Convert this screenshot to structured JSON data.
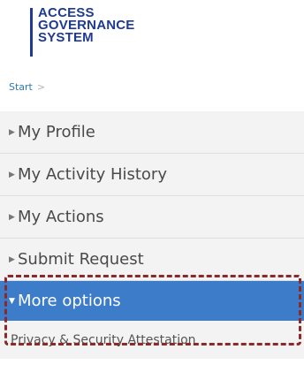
{
  "logo": {
    "line1": "ACCESS",
    "line2": "GOVERNANCE",
    "line3": "SYSTEM"
  },
  "breadcrumb": {
    "start": "Start",
    "separator": ">"
  },
  "nav": {
    "items": [
      {
        "label": "My Profile",
        "arrow": "▶"
      },
      {
        "label": "My Activity History",
        "arrow": "▶"
      },
      {
        "label": "My Actions",
        "arrow": "▶"
      },
      {
        "label": "Submit Request",
        "arrow": "▶"
      }
    ],
    "active": {
      "label": "More options",
      "arrow": "▼"
    },
    "subitems": [
      {
        "label": "Privacy & Security Attestation"
      }
    ]
  },
  "colors": {
    "brand": "#1f3a93",
    "active": "#3d7cc9",
    "highlight": "#8b2a2a",
    "link": "#2e7ab8"
  }
}
